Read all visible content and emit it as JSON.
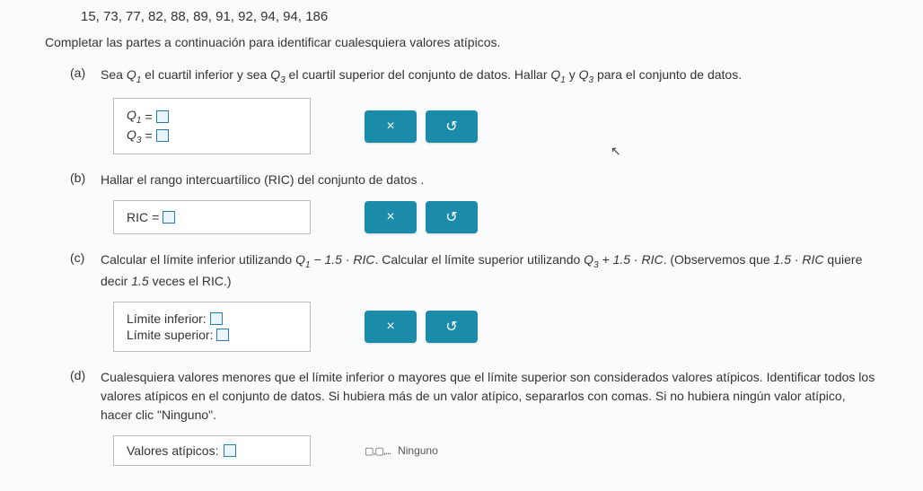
{
  "data_values": "15, 73, 77, 82, 88, 89, 91, 92, 94, 94, 186",
  "instruction": "Completar las partes a continuación para identificar cualesquiera valores atípicos.",
  "parts": {
    "a": {
      "label": "(a)",
      "text_1": "Sea ",
      "q1": "Q",
      "q1_sub": "1",
      "text_2": " el cuartil inferior y sea ",
      "q3": "Q",
      "q3_sub": "3",
      "text_3": " el cuartil superior del conjunto de datos. Hallar ",
      "text_4": " y ",
      "text_5": " para el conjunto de datos.",
      "answer": {
        "line1_sym": "Q",
        "line1_sub": "1",
        "eq": " = ",
        "line2_sym": "Q",
        "line2_sub": "3"
      }
    },
    "b": {
      "label": "(b)",
      "text": "Hallar el rango intercuartílico (RIC) del conjunto de datos .",
      "answer": {
        "label": "RIC",
        "eq": " = "
      }
    },
    "c": {
      "label": "(c)",
      "text_1": "Calcular el límite inferior utilizando ",
      "expr_1a": "Q",
      "expr_1a_sub": "1",
      "expr_1b": " − 1.5 · RIC",
      "text_2": ". Calcular el límite superior utilizando ",
      "expr_2a": "Q",
      "expr_2a_sub": "3",
      "expr_2b": " + 1.5 · RIC",
      "text_3": ". (Observemos que ",
      "expr_3": "1.5 · RIC",
      "text_4": " quiere decir ",
      "expr_4": "1.5",
      "text_5": " veces el RIC.)",
      "answer": {
        "line1": "Límite inferior: ",
        "line2": "Límite superior: "
      }
    },
    "d": {
      "label": "(d)",
      "text": "Cualesquiera valores menores que el límite inferior o mayores que el límite superior son considerados valores atípicos. Identificar todos los valores atípicos en el conjunto de datos. Si hubiera más de un valor atípico, separarlos con comas. Si no hubiera ningún valor atípico, hacer clic \"Ninguno\".",
      "answer": {
        "label": "Valores atípicos: ",
        "ninguno": "Ninguno",
        "mini": "▢,▢,..."
      }
    }
  },
  "buttons": {
    "clear": "×",
    "reset": "↺"
  }
}
